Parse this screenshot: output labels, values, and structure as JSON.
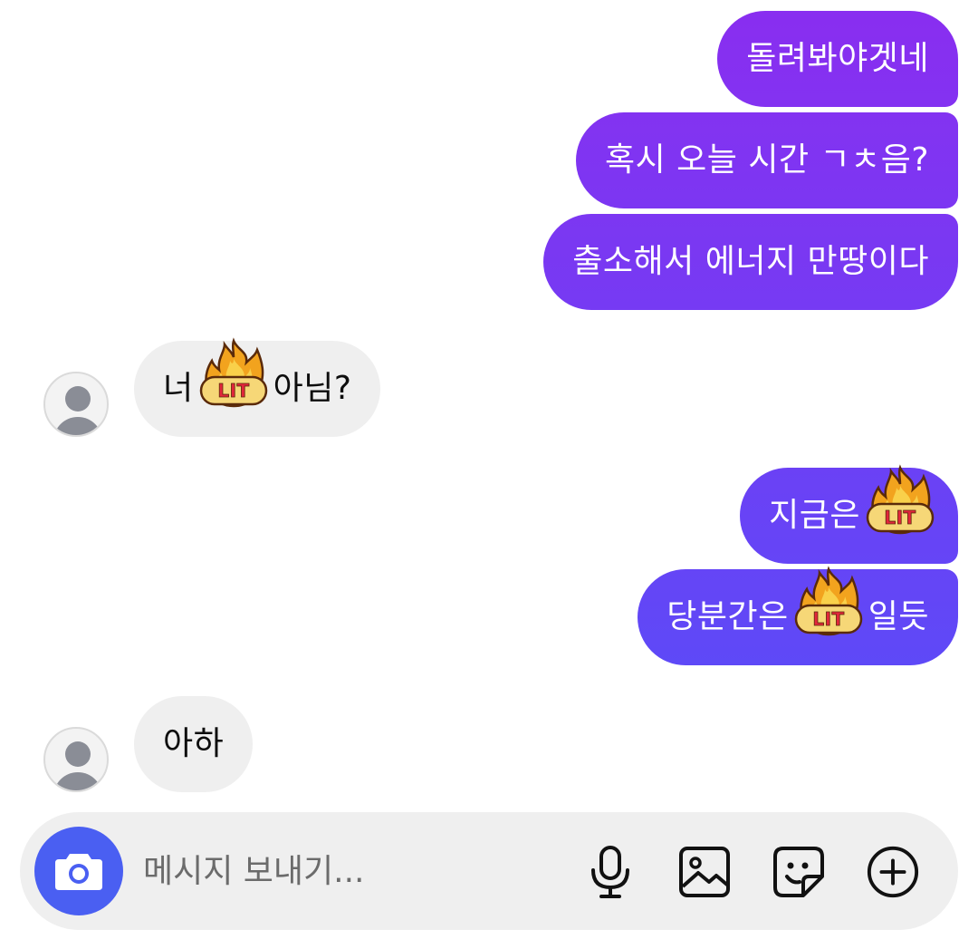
{
  "colors": {
    "outgoing_top": "#8a2ef0",
    "outgoing_bottom": "#5e49f7",
    "incoming_bg": "#efefef",
    "camera_button": "#4a5ff2"
  },
  "messages": [
    {
      "direction": "out",
      "parts": [
        {
          "text": "돌려봐야겟네"
        }
      ]
    },
    {
      "direction": "out",
      "parts": [
        {
          "text": "혹시 오늘 시간 ㄱㅊ음?"
        }
      ]
    },
    {
      "direction": "out",
      "parts": [
        {
          "text": "출소해서 에너지 만땅이다"
        }
      ]
    },
    {
      "direction": "in",
      "parts": [
        {
          "text": "너"
        },
        {
          "sticker": "LIT"
        },
        {
          "text": "아님?"
        }
      ]
    },
    {
      "direction": "out",
      "parts": [
        {
          "text": "지금은"
        },
        {
          "sticker": "LIT"
        }
      ]
    },
    {
      "direction": "out",
      "parts": [
        {
          "text": "당분간은"
        },
        {
          "sticker": "LIT"
        },
        {
          "text": "일듯"
        }
      ]
    },
    {
      "direction": "in",
      "parts": [
        {
          "text": "아하"
        }
      ]
    }
  ],
  "composer": {
    "placeholder": "메시지 보내기...",
    "icons": [
      "camera-icon",
      "microphone-icon",
      "gallery-icon",
      "sticker-icon",
      "add-icon"
    ]
  }
}
